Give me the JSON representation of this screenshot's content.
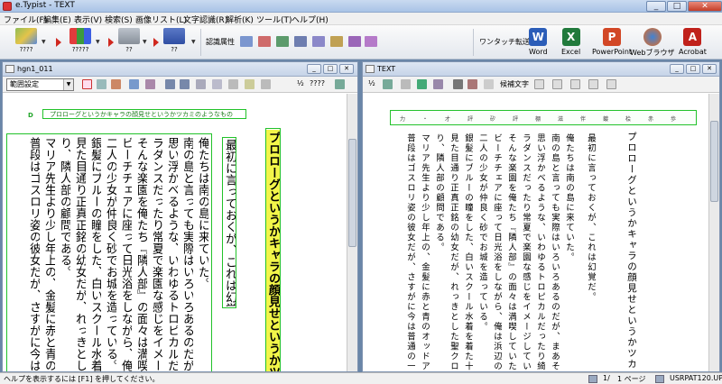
{
  "window": {
    "title": "e.Typist - TEXT",
    "min": "_",
    "max": "□",
    "close": "✕"
  },
  "menu": [
    "ファイル(F)",
    "編集(E)",
    "表示(V)",
    "検索(S)",
    "画像リスト(L)",
    "文字認識(R)",
    "解析(K)",
    "ツール(T)",
    "ヘルプ(H)"
  ],
  "toolbar": {
    "btn1_label": "????",
    "btn2_label": "?????",
    "btn3_label": "??",
    "btn4_label": "??",
    "recog_attr_label": "認識属性",
    "one_touch_label": "ワンタッチ転送",
    "apps": [
      "Word",
      "Excel",
      "PowerPoint",
      "Webブラウザ",
      "Acrobat"
    ],
    "colors": {
      "arrow": "#d0281f",
      "word": "#2b5db8",
      "excel": "#217a3c",
      "ppt": "#d24726",
      "acrobat": "#c0211b"
    }
  },
  "left_pane": {
    "title": "hgn1_011",
    "select_value": "範囲設定",
    "zoom_label": "½",
    "zoom_text": "????",
    "heading": "プロローグというかキャラの顔見せというかツ",
    "subheading": "最初に言っておくが、これは幻覚だ。",
    "horizontal_line": "プロローグというかキャラの顔見せというかツカミのようなもの",
    "body_lines": [
      "俺たちは南の島に来ていた。",
      "南の島と言っても実際はいろいろあるのだが、まあそ",
      "思い浮かべるような、いわゆるトロピカルだったり綺麗",
      "ラダンスだったり常夏で楽園な感じをイメージしてもら",
      "そんな楽園を俺たち『隣人部』の面々は満喫していた",
      "ビーチチェアに座って日光浴をしながら、俺は浜辺の",
      "二人の少女が仲良く砂でお城を造っている。",
      "銀髪にブルーの瞳をした、白いスクール水着を着た十",
      "見た目通り正真正銘の幼女だが、れっきとした聖クロ",
      "り、隣人部の顧問である。",
      "マリア先生より少し年上の、金髪に赤と青のオッドア",
      "普段はゴスロリ姿の彼女だが、さすがに今は普通の一"
    ]
  },
  "right_pane": {
    "title": "TEXT",
    "zoom_label": "½",
    "candidate_label": "候補文字",
    "ruler": [
      "力",
      "・",
      "才",
      "評",
      "矽",
      "評",
      "棚",
      "滋",
      "伴",
      "鍍",
      "桧",
      "赤",
      "歩"
    ],
    "heading": "プロローグというかキャラの顔見せというかツカミ",
    "subheading": "最初に言っておくが、これは幻覚だ。",
    "body_lines": [
      "俺たちは南の島に来ていた。",
      "南の島と言っても実際はいろいろあるのだが、まあそ",
      "思い浮かべるような、いわゆるトロピカルだったり綺麗",
      "ラダンスだったり常夏で楽園な感じをイメージしていた",
      "そんな楽園を俺たち『隣人部』の面々は満喫していた",
      "ビーチチェアに座って日光浴をしながら、俺は浜辺の",
      "二人の少女が仲良く砂でお城を造っている。",
      "銀髪にブルーの瞳をした、白いスクール水着を着た十",
      "見た目通り正真正銘の幼女だが、れっきとした聖クロ",
      "り、隣人部の顧問である。",
      "マリア先生より少し年上の、金髪に赤と青のオッドア",
      "普段はゴスロリ姿の彼女だが、さすがに今は普通の一"
    ]
  },
  "status": {
    "help_text": "ヘルプを表示するには [F1] を押してください。",
    "page": "1/",
    "page_of": "1 ページ",
    "file": "USRPAT120.UPT"
  }
}
